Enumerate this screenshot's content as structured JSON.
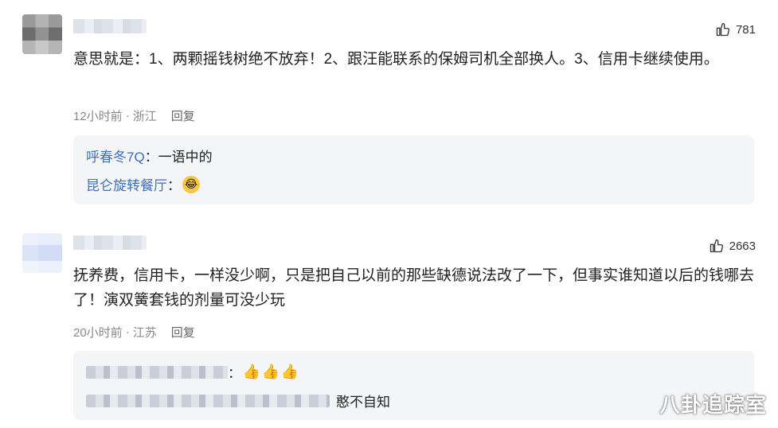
{
  "comments": [
    {
      "likes": "781",
      "text": "意思就是：1、两颗摇钱树绝不放弃！2、跟汪能联系的保姆司机全部换人。3、信用卡继续使用。",
      "time": "12小时前",
      "sep": "·",
      "location": "浙江",
      "reply_label": "回复",
      "replies": [
        {
          "name": "呼春冬7Q",
          "text": "：一语中的"
        },
        {
          "name": "昆仑旋转餐厅",
          "text": "：",
          "emoji": "face-with-tears-emoji"
        }
      ]
    },
    {
      "likes": "2663",
      "text": "抚养费，信用卡，一样没少啊，只是把自己以前的那些缺德说法改了一下，但事实谁知道以后的钱哪去了！演双簧套钱的剂量可没少玩",
      "time": "20小时前",
      "sep": "·",
      "location": "江苏",
      "reply_label": "回复",
      "replies": [
        {
          "text": "：",
          "emoji": "thumbs-up-emoji"
        },
        {
          "text": "憨不自知"
        }
      ]
    }
  ],
  "watermark": "八卦追踪室"
}
